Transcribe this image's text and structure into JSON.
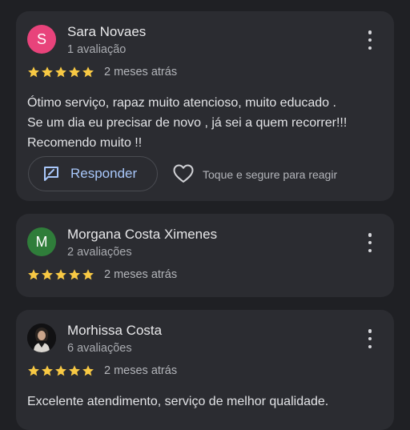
{
  "colors": {
    "background": "#1f2024",
    "card": "#2b2c31",
    "star": "#f8c944",
    "reply_accent": "#a8c7fa",
    "avatar_sara": "#e8437b",
    "avatar_morgana": "#2f7d3a"
  },
  "reviews": [
    {
      "avatar_initial": "S",
      "name": "Sara Novaes",
      "review_count": "1 avaliação",
      "rating": 5,
      "date": "2 meses atrás",
      "text_lines": [
        "Ótimo serviço, rapaz muito atencioso, muito educado .",
        "Se um dia eu precisar de novo , já sei a quem recorrer!!!",
        "Recomendo muito !!"
      ],
      "reply_label": "Responder",
      "react_hint": "Toque e segure para reagir"
    },
    {
      "avatar_initial": "M",
      "name": "Morgana Costa Ximenes",
      "review_count": "2 avaliações",
      "rating": 5,
      "date": "2 meses atrás"
    },
    {
      "avatar_icon": "profile-photo",
      "name": "Morhissa Costa",
      "review_count": "6 avaliações",
      "rating": 5,
      "date": "2 meses atrás",
      "text_lines": [
        "Excelente atendimento, serviço de melhor qualidade."
      ]
    }
  ]
}
